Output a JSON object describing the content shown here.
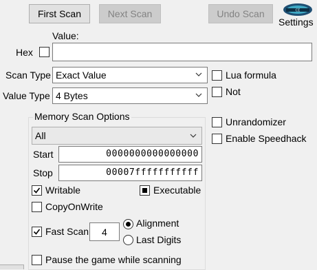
{
  "toolbar": {
    "first_scan": "First Scan",
    "next_scan": "Next Scan",
    "undo_scan": "Undo Scan",
    "settings": "Settings",
    "logo_text": "Cheat Engine"
  },
  "value": {
    "label": "Value:",
    "hex_label": "Hex",
    "input_value": ""
  },
  "scan_type": {
    "label": "Scan Type",
    "selected": "Exact Value"
  },
  "value_type": {
    "label": "Value Type",
    "selected": "4 Bytes"
  },
  "options_right": {
    "lua_formula": "Lua formula",
    "not": "Not",
    "unrandomizer": "Unrandomizer",
    "enable_speedhack": "Enable Speedhack"
  },
  "memory_scan": {
    "title": "Memory Scan Options",
    "region": "All",
    "start_label": "Start",
    "start_value": "0000000000000000",
    "stop_label": "Stop",
    "stop_value": "00007fffffffffff",
    "writable": "Writable",
    "executable": "Executable",
    "copy_on_write": "CopyOnWrite",
    "fast_scan": "Fast Scan",
    "fast_scan_value": "4",
    "alignment": "Alignment",
    "last_digits": "Last Digits",
    "pause": "Pause the game while scanning"
  },
  "states": {
    "hex_checked": false,
    "lua_checked": false,
    "not_checked": false,
    "unrandomizer_checked": false,
    "speedhack_checked": false,
    "writable_checked": true,
    "executable_state": "indeterminate",
    "copy_on_write_checked": false,
    "fast_scan_checked": true,
    "alignment_selected": true,
    "pause_checked": false
  }
}
